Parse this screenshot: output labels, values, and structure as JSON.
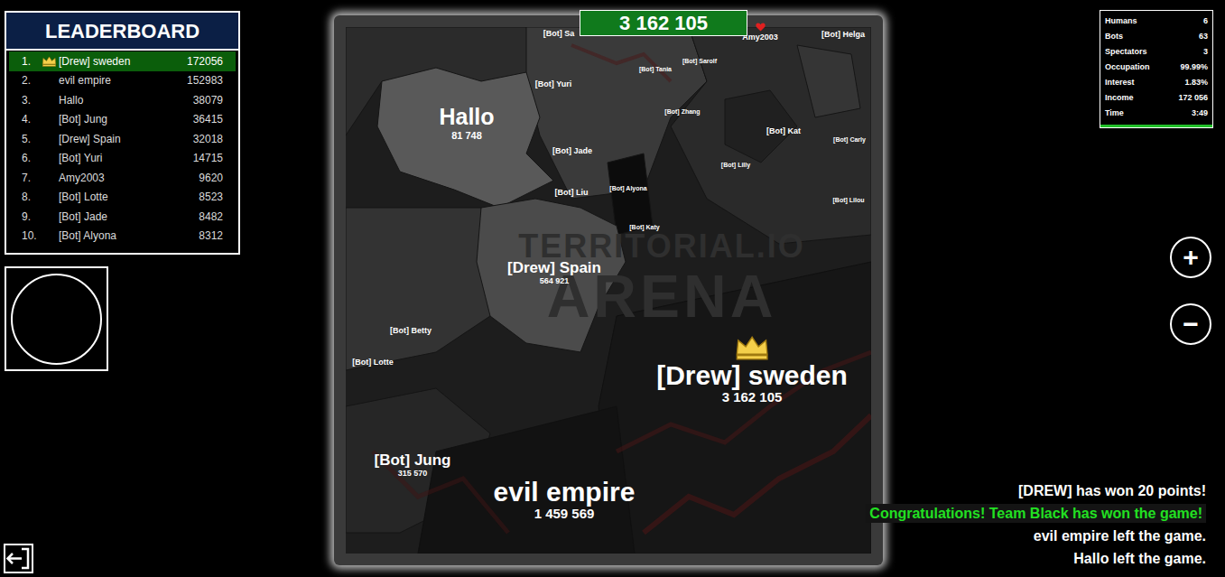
{
  "leaderboard": {
    "title": "LEADERBOARD",
    "rows": [
      {
        "rank": "1.",
        "name": "[Drew] sweden",
        "score": "172056",
        "selected": true,
        "crowned": true
      },
      {
        "rank": "2.",
        "name": "evil empire",
        "score": "152983",
        "selected": false,
        "crowned": false
      },
      {
        "rank": "3.",
        "name": "Hallo",
        "score": "38079",
        "selected": false,
        "crowned": false
      },
      {
        "rank": "4.",
        "name": "[Bot] Jung",
        "score": "36415",
        "selected": false,
        "crowned": false
      },
      {
        "rank": "5.",
        "name": "[Drew] Spain",
        "score": "32018",
        "selected": false,
        "crowned": false
      },
      {
        "rank": "6.",
        "name": "[Bot] Yuri",
        "score": "14715",
        "selected": false,
        "crowned": false
      },
      {
        "rank": "7.",
        "name": "Amy2003",
        "score": "9620",
        "selected": false,
        "crowned": false
      },
      {
        "rank": "8.",
        "name": "[Bot] Lotte",
        "score": "8523",
        "selected": false,
        "crowned": false
      },
      {
        "rank": "9.",
        "name": "[Bot] Jade",
        "score": "8482",
        "selected": false,
        "crowned": false
      },
      {
        "rank": "10.",
        "name": "[Bot] Alyona",
        "score": "8312",
        "selected": false,
        "crowned": false
      }
    ]
  },
  "top_score": "3 162 105",
  "stats": {
    "rows": [
      {
        "label": "Humans",
        "value": "6"
      },
      {
        "label": "Bots",
        "value": "63"
      },
      {
        "label": "Spectators",
        "value": "3"
      },
      {
        "label": "Occupation",
        "value": "99.99%"
      },
      {
        "label": "Interest",
        "value": "1.83%"
      },
      {
        "label": "Income",
        "value": "172 056"
      },
      {
        "label": "Time",
        "value": "3:49"
      }
    ],
    "level": 1
  },
  "map": {
    "watermark": [
      "TERRITORIAL.IO",
      "ARENA"
    ],
    "labels": [
      {
        "name": "[Bot] Sa",
        "score": "",
        "kind": "small",
        "crowned": false
      },
      {
        "name": "Amy2003",
        "score": "",
        "kind": "small",
        "crowned": false
      },
      {
        "name": "[Bot] Helga",
        "score": "",
        "kind": "small",
        "crowned": false
      },
      {
        "name": "[Bot] Tania",
        "score": "",
        "kind": "tiny",
        "crowned": false
      },
      {
        "name": "[Bot] Sarolf",
        "score": "",
        "kind": "tiny",
        "crowned": false
      },
      {
        "name": "[Bot] Yuri",
        "score": "",
        "kind": "small",
        "crowned": false
      },
      {
        "name": "Hallo",
        "score": "81 748",
        "kind": "large",
        "crowned": false
      },
      {
        "name": "[Bot] Zhang",
        "score": "",
        "kind": "tiny",
        "crowned": false
      },
      {
        "name": "[Bot] Kat",
        "score": "",
        "kind": "small",
        "crowned": false
      },
      {
        "name": "[Bot] Carly",
        "score": "",
        "kind": "tiny",
        "crowned": false
      },
      {
        "name": "[Bot] Jade",
        "score": "",
        "kind": "small",
        "crowned": false
      },
      {
        "name": "[Bot] Lilly",
        "score": "",
        "kind": "tiny",
        "crowned": false
      },
      {
        "name": "[Bot] Liu",
        "score": "",
        "kind": "small",
        "crowned": false
      },
      {
        "name": "[Bot] Alyona",
        "score": "",
        "kind": "tiny",
        "crowned": false
      },
      {
        "name": "[Bot] Lilou",
        "score": "",
        "kind": "tiny",
        "crowned": false
      },
      {
        "name": "[Bot] Katy",
        "score": "",
        "kind": "tiny",
        "crowned": false
      },
      {
        "name": "[Drew] Spain",
        "score": "564 921",
        "kind": "medium",
        "crowned": false
      },
      {
        "name": "[Bot] Betty",
        "score": "",
        "kind": "small",
        "crowned": false
      },
      {
        "name": "[Bot] Lotte",
        "score": "",
        "kind": "small",
        "crowned": false
      },
      {
        "name": "[Drew] sweden",
        "score": "3 162 105",
        "kind": "huge",
        "crowned": true
      },
      {
        "name": "[Bot] Jung",
        "score": "315 570",
        "kind": "medium",
        "crowned": false
      },
      {
        "name": "evil empire",
        "score": "1 459 569",
        "kind": "huge",
        "crowned": false
      }
    ]
  },
  "zoom_buttons": [
    "+",
    "−"
  ],
  "messages": [
    {
      "text": "[DREW] has won 20 points!",
      "highlighted": false
    },
    {
      "text": "Congratulations! Team Black has won the game!",
      "highlighted": true
    },
    {
      "text": "evil empire left the game.",
      "highlighted": false
    },
    {
      "text": "Hallo left the game.",
      "highlighted": false
    }
  ]
}
